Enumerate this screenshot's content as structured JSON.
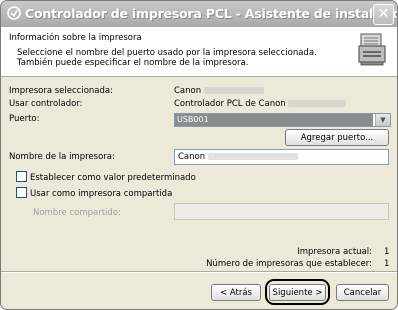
{
  "window": {
    "title": "Controlador de impresora PCL - Asistente de instalación",
    "close_symbol": "✕"
  },
  "header": {
    "title": "Información sobre la impresora",
    "line1": "Seleccione el nombre del puerto usado por la impresora seleccionada.",
    "line2": "También puede especificar el nombre de la impresora.",
    "icon": "printer-icon"
  },
  "fields": {
    "printer_label": "Impresora seleccionada:",
    "printer_value": "Canon",
    "driver_label": "Usar controlador:",
    "driver_value": "Controlador PCL de Canon",
    "port_label": "Puerto:",
    "port_value": "USB001",
    "name_label": "Nombre de la impresora:",
    "name_value": "Canon",
    "shared_label": "Nombre compartido:"
  },
  "buttons": {
    "add_port": "Agregar puerto...",
    "back": "< Atrás",
    "next": "Siguiente >",
    "cancel": "Cancelar"
  },
  "checkboxes": {
    "default": "Establecer como valor predeterminado",
    "shared": "Usar como impresora compartida"
  },
  "stats": {
    "current_label": "Impresora actual:",
    "current_value": "1",
    "count_label": "Número de impresoras que establecer:",
    "count_value": "1"
  }
}
